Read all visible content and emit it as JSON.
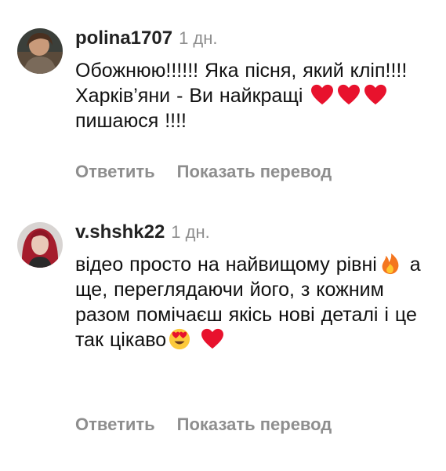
{
  "comments": [
    {
      "username": "polina1707",
      "time": "1 дн.",
      "text_1": "Обожнюю!!!!!! Яка пісня, який кліп!!!! Харків’яни - Ви найкращі",
      "text_2": "пишаюся !!!!",
      "emoji_1": [
        "heart-icon",
        "heart-icon",
        "heart-icon"
      ],
      "reply_label": "Ответить",
      "translate_label": "Показать перевод"
    },
    {
      "username": "v.shshk22",
      "time": "1 дн.",
      "text_1": "відео просто на найвищому рівні",
      "text_2": "а ще, переглядаючи його, з кожним разом помічаєш якісь нові деталі і це так цікаво",
      "reply_label": "Ответить",
      "translate_label": "Показать перевод"
    }
  ],
  "colors": {
    "heart": "#e8122d",
    "meta_gray": "#8e8e8e"
  }
}
